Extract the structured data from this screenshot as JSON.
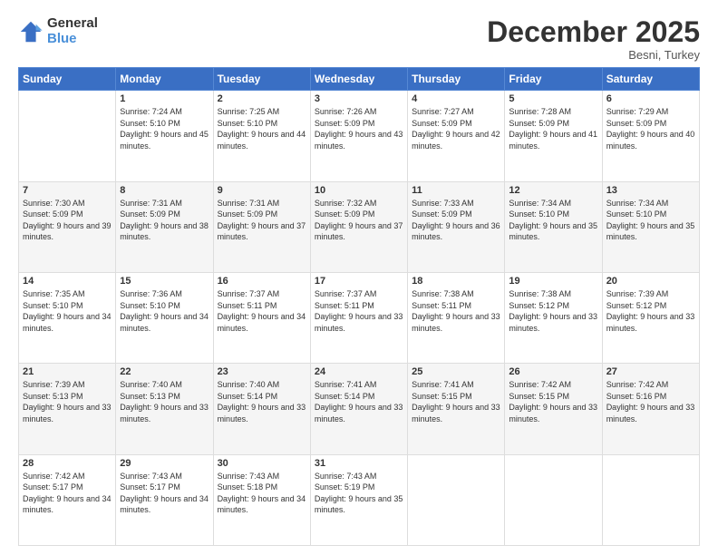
{
  "logo": {
    "general": "General",
    "blue": "Blue"
  },
  "title": "December 2025",
  "location": "Besni, Turkey",
  "days_of_week": [
    "Sunday",
    "Monday",
    "Tuesday",
    "Wednesday",
    "Thursday",
    "Friday",
    "Saturday"
  ],
  "weeks": [
    [
      {
        "day": "",
        "sunrise": "",
        "sunset": "",
        "daylight": ""
      },
      {
        "day": "1",
        "sunrise": "Sunrise: 7:24 AM",
        "sunset": "Sunset: 5:10 PM",
        "daylight": "Daylight: 9 hours and 45 minutes."
      },
      {
        "day": "2",
        "sunrise": "Sunrise: 7:25 AM",
        "sunset": "Sunset: 5:10 PM",
        "daylight": "Daylight: 9 hours and 44 minutes."
      },
      {
        "day": "3",
        "sunrise": "Sunrise: 7:26 AM",
        "sunset": "Sunset: 5:09 PM",
        "daylight": "Daylight: 9 hours and 43 minutes."
      },
      {
        "day": "4",
        "sunrise": "Sunrise: 7:27 AM",
        "sunset": "Sunset: 5:09 PM",
        "daylight": "Daylight: 9 hours and 42 minutes."
      },
      {
        "day": "5",
        "sunrise": "Sunrise: 7:28 AM",
        "sunset": "Sunset: 5:09 PM",
        "daylight": "Daylight: 9 hours and 41 minutes."
      },
      {
        "day": "6",
        "sunrise": "Sunrise: 7:29 AM",
        "sunset": "Sunset: 5:09 PM",
        "daylight": "Daylight: 9 hours and 40 minutes."
      }
    ],
    [
      {
        "day": "7",
        "sunrise": "Sunrise: 7:30 AM",
        "sunset": "Sunset: 5:09 PM",
        "daylight": "Daylight: 9 hours and 39 minutes."
      },
      {
        "day": "8",
        "sunrise": "Sunrise: 7:31 AM",
        "sunset": "Sunset: 5:09 PM",
        "daylight": "Daylight: 9 hours and 38 minutes."
      },
      {
        "day": "9",
        "sunrise": "Sunrise: 7:31 AM",
        "sunset": "Sunset: 5:09 PM",
        "daylight": "Daylight: 9 hours and 37 minutes."
      },
      {
        "day": "10",
        "sunrise": "Sunrise: 7:32 AM",
        "sunset": "Sunset: 5:09 PM",
        "daylight": "Daylight: 9 hours and 37 minutes."
      },
      {
        "day": "11",
        "sunrise": "Sunrise: 7:33 AM",
        "sunset": "Sunset: 5:09 PM",
        "daylight": "Daylight: 9 hours and 36 minutes."
      },
      {
        "day": "12",
        "sunrise": "Sunrise: 7:34 AM",
        "sunset": "Sunset: 5:10 PM",
        "daylight": "Daylight: 9 hours and 35 minutes."
      },
      {
        "day": "13",
        "sunrise": "Sunrise: 7:34 AM",
        "sunset": "Sunset: 5:10 PM",
        "daylight": "Daylight: 9 hours and 35 minutes."
      }
    ],
    [
      {
        "day": "14",
        "sunrise": "Sunrise: 7:35 AM",
        "sunset": "Sunset: 5:10 PM",
        "daylight": "Daylight: 9 hours and 34 minutes."
      },
      {
        "day": "15",
        "sunrise": "Sunrise: 7:36 AM",
        "sunset": "Sunset: 5:10 PM",
        "daylight": "Daylight: 9 hours and 34 minutes."
      },
      {
        "day": "16",
        "sunrise": "Sunrise: 7:37 AM",
        "sunset": "Sunset: 5:11 PM",
        "daylight": "Daylight: 9 hours and 34 minutes."
      },
      {
        "day": "17",
        "sunrise": "Sunrise: 7:37 AM",
        "sunset": "Sunset: 5:11 PM",
        "daylight": "Daylight: 9 hours and 33 minutes."
      },
      {
        "day": "18",
        "sunrise": "Sunrise: 7:38 AM",
        "sunset": "Sunset: 5:11 PM",
        "daylight": "Daylight: 9 hours and 33 minutes."
      },
      {
        "day": "19",
        "sunrise": "Sunrise: 7:38 AM",
        "sunset": "Sunset: 5:12 PM",
        "daylight": "Daylight: 9 hours and 33 minutes."
      },
      {
        "day": "20",
        "sunrise": "Sunrise: 7:39 AM",
        "sunset": "Sunset: 5:12 PM",
        "daylight": "Daylight: 9 hours and 33 minutes."
      }
    ],
    [
      {
        "day": "21",
        "sunrise": "Sunrise: 7:39 AM",
        "sunset": "Sunset: 5:13 PM",
        "daylight": "Daylight: 9 hours and 33 minutes."
      },
      {
        "day": "22",
        "sunrise": "Sunrise: 7:40 AM",
        "sunset": "Sunset: 5:13 PM",
        "daylight": "Daylight: 9 hours and 33 minutes."
      },
      {
        "day": "23",
        "sunrise": "Sunrise: 7:40 AM",
        "sunset": "Sunset: 5:14 PM",
        "daylight": "Daylight: 9 hours and 33 minutes."
      },
      {
        "day": "24",
        "sunrise": "Sunrise: 7:41 AM",
        "sunset": "Sunset: 5:14 PM",
        "daylight": "Daylight: 9 hours and 33 minutes."
      },
      {
        "day": "25",
        "sunrise": "Sunrise: 7:41 AM",
        "sunset": "Sunset: 5:15 PM",
        "daylight": "Daylight: 9 hours and 33 minutes."
      },
      {
        "day": "26",
        "sunrise": "Sunrise: 7:42 AM",
        "sunset": "Sunset: 5:15 PM",
        "daylight": "Daylight: 9 hours and 33 minutes."
      },
      {
        "day": "27",
        "sunrise": "Sunrise: 7:42 AM",
        "sunset": "Sunset: 5:16 PM",
        "daylight": "Daylight: 9 hours and 33 minutes."
      }
    ],
    [
      {
        "day": "28",
        "sunrise": "Sunrise: 7:42 AM",
        "sunset": "Sunset: 5:17 PM",
        "daylight": "Daylight: 9 hours and 34 minutes."
      },
      {
        "day": "29",
        "sunrise": "Sunrise: 7:43 AM",
        "sunset": "Sunset: 5:17 PM",
        "daylight": "Daylight: 9 hours and 34 minutes."
      },
      {
        "day": "30",
        "sunrise": "Sunrise: 7:43 AM",
        "sunset": "Sunset: 5:18 PM",
        "daylight": "Daylight: 9 hours and 34 minutes."
      },
      {
        "day": "31",
        "sunrise": "Sunrise: 7:43 AM",
        "sunset": "Sunset: 5:19 PM",
        "daylight": "Daylight: 9 hours and 35 minutes."
      },
      {
        "day": "",
        "sunrise": "",
        "sunset": "",
        "daylight": ""
      },
      {
        "day": "",
        "sunrise": "",
        "sunset": "",
        "daylight": ""
      },
      {
        "day": "",
        "sunrise": "",
        "sunset": "",
        "daylight": ""
      }
    ]
  ]
}
